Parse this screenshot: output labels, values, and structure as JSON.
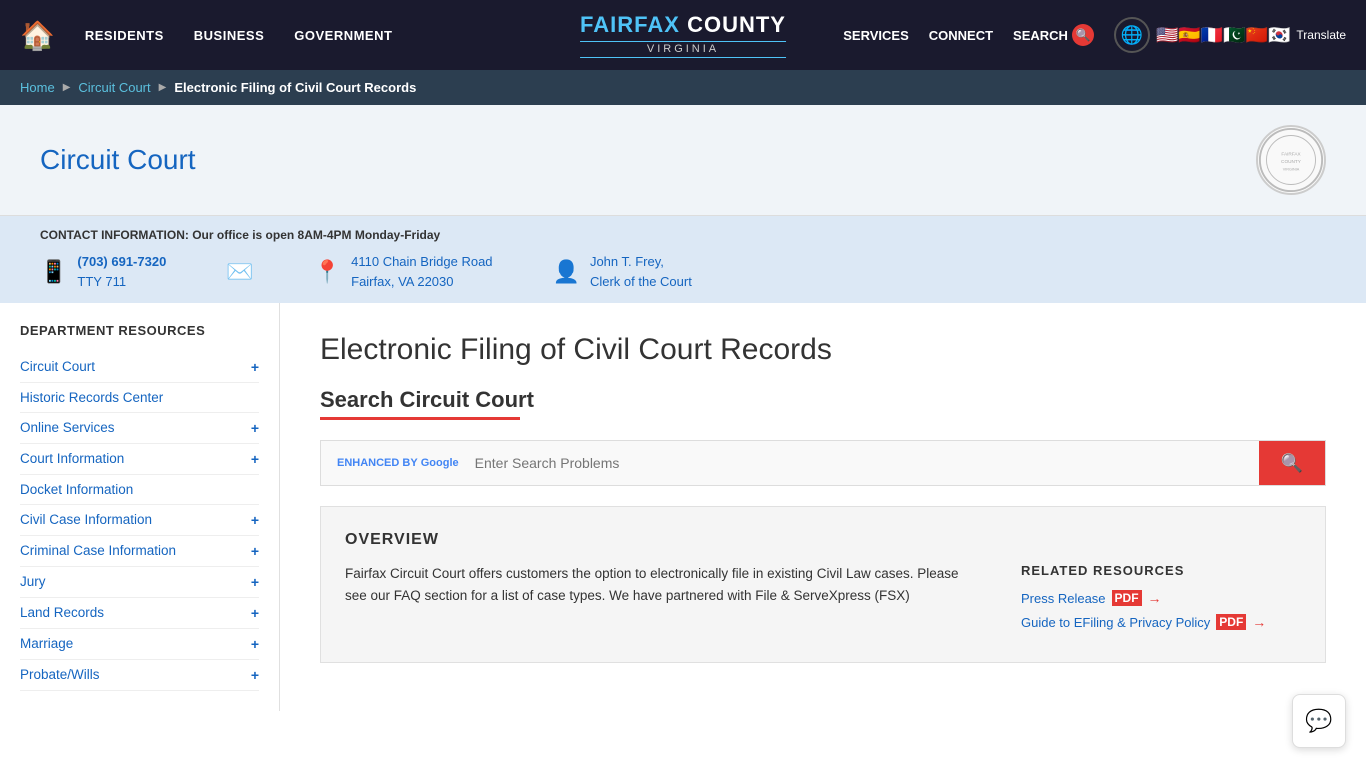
{
  "nav": {
    "home_icon": "🏠",
    "links": [
      {
        "label": "RESIDENTS",
        "id": "residents"
      },
      {
        "label": "BUSINESS",
        "id": "business"
      },
      {
        "label": "GOVERNMENT",
        "id": "government"
      }
    ],
    "brand": {
      "name_part1": "FAIRFAX",
      "name_part2": "COUNTY",
      "subtitle": "VIRGINIA"
    },
    "right_links": [
      {
        "label": "SERVICES",
        "id": "services"
      },
      {
        "label": "CONNECT",
        "id": "connect"
      },
      {
        "label": "SEARCH",
        "id": "search"
      }
    ],
    "translate_label": "Translate"
  },
  "breadcrumb": {
    "home": "Home",
    "parent": "Circuit Court",
    "current": "Electronic Filing of Civil Court Records"
  },
  "page_header": {
    "title": "Circuit Court",
    "seal_label": "Seal"
  },
  "contact": {
    "label": "CONTACT INFORMATION: Our office is open 8AM-4PM Monday-Friday",
    "phone": "(703) 691-7320",
    "tty": "TTY 711",
    "address_line1": "4110 Chain Bridge Road",
    "address_line2": "Fairfax, VA 22030",
    "clerk_name": "John T. Frey,",
    "clerk_title": "Clerk of the Court"
  },
  "sidebar": {
    "dept_title": "DEPARTMENT RESOURCES",
    "items": [
      {
        "label": "Circuit Court",
        "has_plus": true,
        "id": "circuit-court"
      },
      {
        "label": "Historic Records Center",
        "has_plus": false,
        "id": "historic-records"
      },
      {
        "label": "Online Services",
        "has_plus": true,
        "id": "online-services"
      },
      {
        "label": "Court Information",
        "has_plus": true,
        "id": "court-information"
      },
      {
        "label": "Docket Information",
        "has_plus": false,
        "id": "docket-information"
      },
      {
        "label": "Civil Case Information",
        "has_plus": true,
        "id": "civil-case"
      },
      {
        "label": "Criminal Case Information",
        "has_plus": true,
        "id": "criminal-case"
      },
      {
        "label": "Jury",
        "has_plus": true,
        "id": "jury"
      },
      {
        "label": "Land Records",
        "has_plus": true,
        "id": "land-records"
      },
      {
        "label": "Marriage",
        "has_plus": true,
        "id": "marriage"
      },
      {
        "label": "Probate/Wills",
        "has_plus": true,
        "id": "probate-wills"
      }
    ]
  },
  "content": {
    "page_title": "Electronic Filing of Civil Court Records",
    "search_title": "Search Circuit Court",
    "search_placeholder": "Enter Search Problems",
    "search_enhanced_label": "ENHANCED BY",
    "search_google_label": "Google",
    "overview_header": "OVERVIEW",
    "overview_text": "Fairfax Circuit Court offers customers the option to electronically file in existing Civil Law cases. Please see our FAQ section for a list of case types. We have partnered with File & ServeXpress (FSX)",
    "related_resources_header": "RELATED RESOURCES",
    "related_links": [
      {
        "label": "Press Release",
        "has_pdf": true,
        "has_arrow": true,
        "id": "press-release"
      },
      {
        "label": "Guide to EFiling & Privacy Policy",
        "has_pdf": true,
        "has_arrow": true,
        "id": "guide-efiling"
      }
    ]
  }
}
